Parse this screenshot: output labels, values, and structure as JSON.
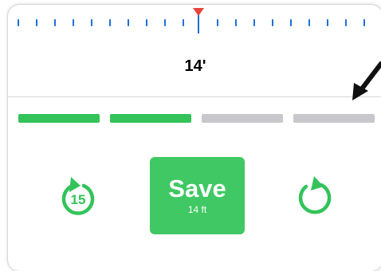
{
  "measurement": {
    "value_label": "14'"
  },
  "progress": {
    "total_steps": 4,
    "completed_steps": 2
  },
  "actions": {
    "replay_15_label": "15",
    "save_label": "Save",
    "save_sublabel": "14 ft"
  },
  "colors": {
    "ruler_tick": "#1e6fd6",
    "ruler_marker": "#e8433a",
    "accent_green": "#33c35a",
    "inactive_gray": "#c7c7cc"
  },
  "icons": {
    "replay": "replay-15-icon",
    "redo": "redo-icon",
    "marker": "triangle-marker-icon",
    "annotation": "annotation-arrow-icon"
  }
}
